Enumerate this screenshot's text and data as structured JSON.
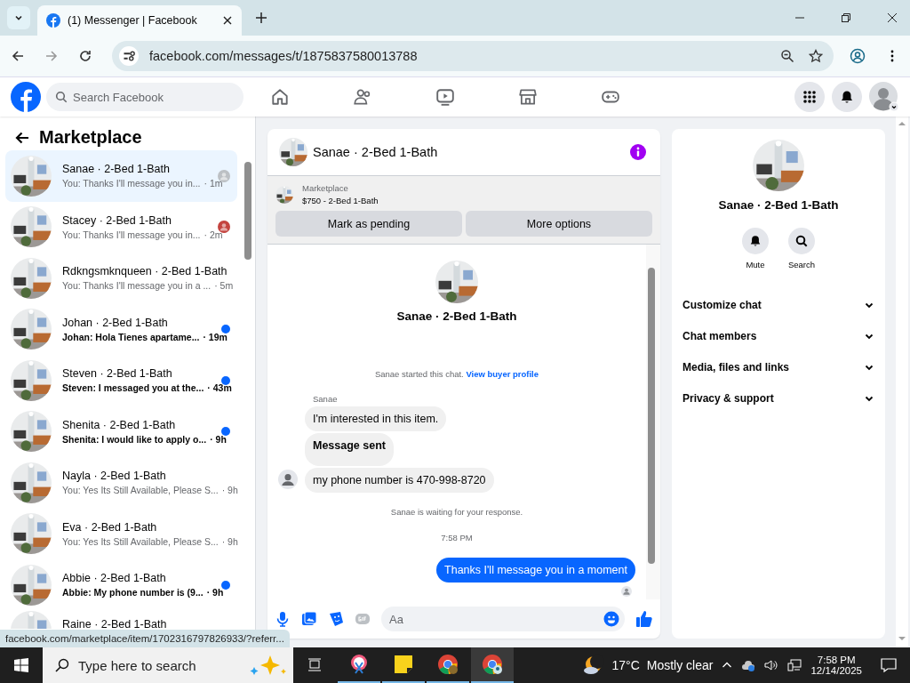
{
  "browser": {
    "tab_title": "(1) Messenger | Facebook",
    "url": "facebook.com/messages/t/1875837580013788"
  },
  "facebook_nav": {
    "search_placeholder": "Search Facebook"
  },
  "inbox": {
    "title": "Marketplace",
    "conversations": [
      {
        "name": "Sanae · 2-Bed 1-Bath",
        "preview": "You: Thanks I'll message you in...",
        "time": "· 1m",
        "selected": true,
        "unread": false,
        "seen": true,
        "color": "#bcc0c4"
      },
      {
        "name": "Stacey · 2-Bed 1-Bath",
        "preview": "You: Thanks I'll message you in...",
        "time": "· 2m",
        "selected": false,
        "unread": false,
        "seen": true,
        "color": "#c4443f"
      },
      {
        "name": "Rdkngsmknqueen · 2-Bed 1-Bath",
        "preview": "You: Thanks I'll message you in a ...",
        "time": "· 5m",
        "selected": false,
        "unread": false
      },
      {
        "name": "Johan · 2-Bed 1-Bath",
        "preview": "Johan: Hola Tienes apartame...",
        "time": "· 19m",
        "selected": false,
        "unread": true
      },
      {
        "name": "Steven · 2-Bed 1-Bath",
        "preview": "Steven: I messaged you at the...",
        "time": "· 43m",
        "selected": false,
        "unread": true
      },
      {
        "name": "Shenita · 2-Bed 1-Bath",
        "preview": "Shenita: I would like to apply o...",
        "time": "· 9h",
        "selected": false,
        "unread": true
      },
      {
        "name": "Nayla · 2-Bed 1-Bath",
        "preview": "You: Yes Its Still Available, Please S...",
        "time": "· 9h",
        "selected": false,
        "unread": false
      },
      {
        "name": "Eva · 2-Bed 1-Bath",
        "preview": "You: Yes Its Still Available, Please S...",
        "time": "· 9h",
        "selected": false,
        "unread": false
      },
      {
        "name": "Abbie · 2-Bed 1-Bath",
        "preview": "Abbie: My phone number is (9...",
        "time": "· 9h",
        "selected": false,
        "unread": true
      },
      {
        "name": "Raine · 2-Bed 1-Bath",
        "selected": false
      }
    ]
  },
  "chat": {
    "title": "Sanae · 2-Bed 1-Bath",
    "listing_label": "Marketplace",
    "listing_title": "$750 - 2-Bed 1-Bath",
    "actions": [
      "Mark as pending",
      "More options"
    ],
    "intro_name": "Sanae · 2-Bed 1-Bath",
    "started_text": "Sanae started this chat.",
    "profile_link": "View buyer profile",
    "sender": "Sanae",
    "messages": [
      {
        "kind": "incoming",
        "text": "I'm interested in this item.",
        "bold": false,
        "avatar": false
      },
      {
        "kind": "incoming",
        "text": "Message sent",
        "bold": true,
        "avatar": false
      },
      {
        "kind": "incoming",
        "text": "my phone number is 470-998-8720",
        "bold": false,
        "avatar": true
      },
      {
        "kind": "notice",
        "text": "Sanae is waiting for your response."
      },
      {
        "kind": "time",
        "text": "7:58 PM"
      },
      {
        "kind": "outgoing",
        "text": "Thanks I'll message you in a moment"
      }
    ],
    "composer_placeholder": "Aa"
  },
  "details": {
    "title": "Sanae · 2-Bed 1-Bath",
    "actions": [
      {
        "kind": "mute",
        "label": "Mute"
      },
      {
        "kind": "search",
        "label": "Search"
      }
    ],
    "sections": [
      "Customize chat",
      "Chat members",
      "Media, files and links",
      "Privacy & support"
    ]
  },
  "status_url": "facebook.com/marketplace/item/1702316797826933/?referr...",
  "taskbar": {
    "search_placeholder": "Type here to search",
    "temperature": "17°C",
    "weather": "Mostly clear",
    "time": "7:58 PM",
    "date": "12/14/2025"
  }
}
